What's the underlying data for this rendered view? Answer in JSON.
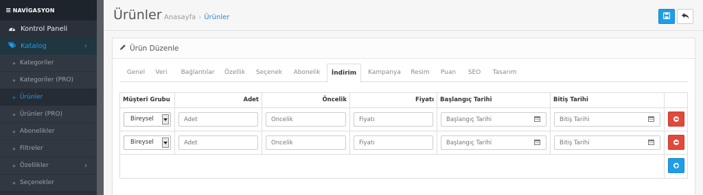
{
  "sidebar": {
    "nav_title": "NAVİGASYON",
    "items": [
      {
        "label": "Kontrol Paneli",
        "icon": "dashboard-icon"
      },
      {
        "label": "Katalog",
        "icon": "tags-icon"
      },
      {
        "label": "Kategoriler"
      },
      {
        "label": "Kategoriler (PRO)"
      },
      {
        "label": "Ürünler"
      },
      {
        "label": "Ürünler (PRO)"
      },
      {
        "label": "Abonelikler"
      },
      {
        "label": "Filtreler"
      },
      {
        "label": "Özellikler"
      },
      {
        "label": "Seçenekler"
      }
    ]
  },
  "header": {
    "title": "Ürünler",
    "breadcrumb_home": "Anasayfa",
    "breadcrumb_sep": "›",
    "breadcrumb_current": "Ürünler"
  },
  "panel": {
    "title": "Ürün Düzenle"
  },
  "tabs": [
    "Genel",
    "Veri",
    "Bağlantılar",
    "Özellik",
    "Seçenek",
    "Abonelik",
    "İndirim",
    "Kampanya",
    "Resim",
    "Puan",
    "SEO",
    "Tasarım"
  ],
  "active_tab": "İndirim",
  "table": {
    "headers": {
      "group": "Müşteri Grubu",
      "quantity": "Adet",
      "priority": "Öncelik",
      "price": "Fiyatı",
      "start": "Başlangıç Tarihi",
      "end": "Bitiş Tarihi"
    },
    "placeholders": {
      "quantity": "Adet",
      "priority": "Öncelik",
      "price": "Fiyatı",
      "start": "Başlangıç Tarihi",
      "end": "Bitiş Tarihi"
    },
    "rows": [
      {
        "group": "Bireysel"
      },
      {
        "group": "Bireysel"
      }
    ]
  },
  "colors": {
    "accent": "#1e9de8",
    "danger": "#e2483b",
    "sidebar_bg": "#2b313b"
  }
}
